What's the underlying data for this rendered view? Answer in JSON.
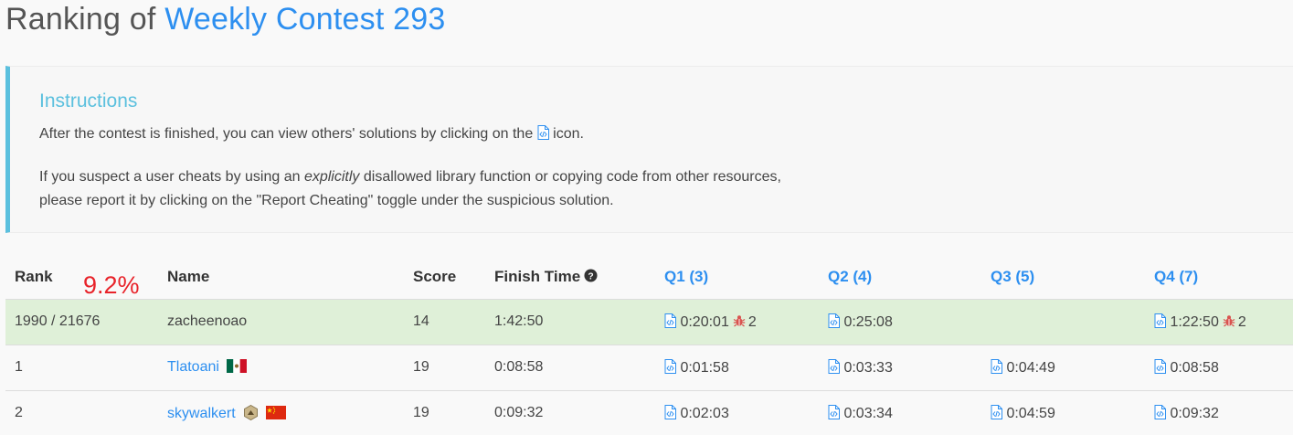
{
  "header": {
    "prefix": "Ranking of ",
    "contest": "Weekly Contest 293"
  },
  "instructions": {
    "heading": "Instructions",
    "line1_before": "After the contest is finished, you can view others' solutions by clicking on the",
    "line1_after": "icon.",
    "line2_before": "If you suspect a user cheats by using an ",
    "line2_em": "explicitly",
    "line2_after": " disallowed library function or copying code from other resources,",
    "line3": "please report it by clicking on the \"Report Cheating\" toggle under the suspicious solution."
  },
  "columns": {
    "rank": "Rank",
    "name": "Name",
    "score": "Score",
    "finish": "Finish Time",
    "q1": "Q1 (3)",
    "q2": "Q2 (4)",
    "q3": "Q3 (5)",
    "q4": "Q4 (7)"
  },
  "annotation": "9.2%",
  "rows": [
    {
      "rank": "1990 / 21676",
      "name": "zacheenoao",
      "score": "14",
      "finish": "1:42:50",
      "q1": "0:20:01",
      "q1_bugs": "2",
      "q2": "0:25:08",
      "q3": "",
      "q4": "1:22:50",
      "q4_bugs": "2"
    },
    {
      "rank": "1",
      "name": "Tlatoani",
      "flag": "mexico-flag",
      "score": "19",
      "finish": "0:08:58",
      "q1": "0:01:58",
      "q2": "0:03:33",
      "q3": "0:04:49",
      "q4": "0:08:58"
    },
    {
      "rank": "2",
      "name": "skywalkert",
      "flag": "china-flag",
      "badge": "badge-icon",
      "score": "19",
      "finish": "0:09:32",
      "q1": "0:02:03",
      "q2": "0:03:34",
      "q3": "0:04:59",
      "q4": "0:09:32"
    }
  ],
  "colors": {
    "accent": "#2d8ff0",
    "info": "#5bc0de",
    "highlight_row": "#dff0d8",
    "bug": "#d9534f",
    "annotation": "#e8232a"
  }
}
